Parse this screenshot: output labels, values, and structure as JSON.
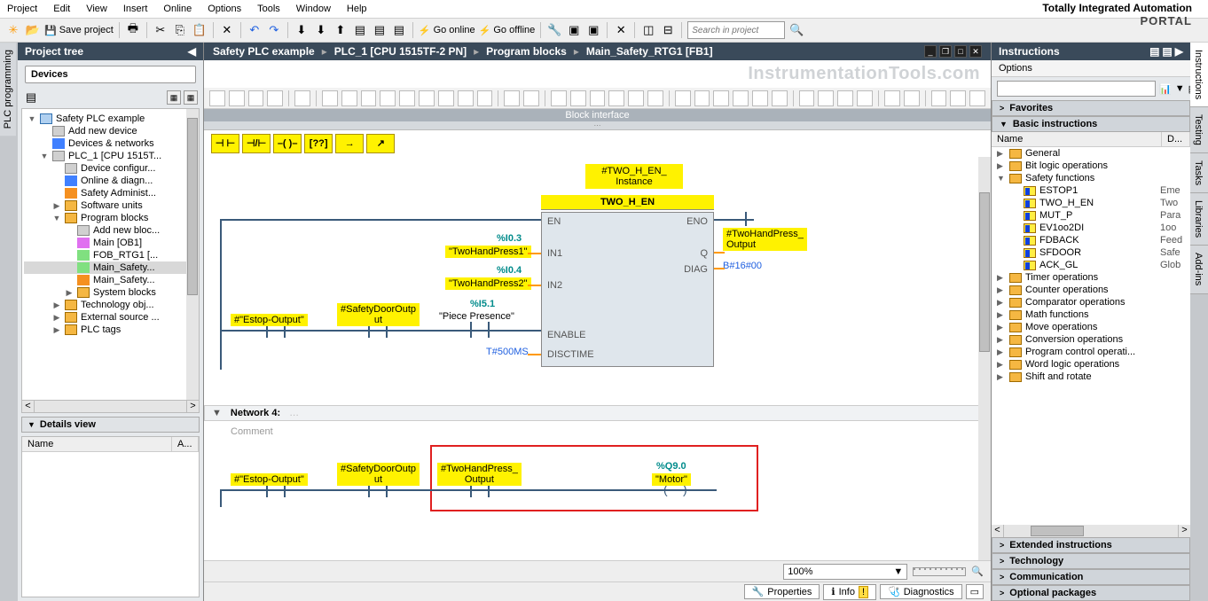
{
  "brand_top": "Totally Integrated Automation",
  "brand_bottom": "PORTAL",
  "menubar": [
    "Project",
    "Edit",
    "View",
    "Insert",
    "Online",
    "Options",
    "Tools",
    "Window",
    "Help"
  ],
  "main_toolbar": {
    "save_label": "Save project",
    "go_online": "Go online",
    "go_offline": "Go offline",
    "search_placeholder": "Search in project"
  },
  "project_tree": {
    "title": "Project tree",
    "devices_tab": "Devices",
    "items": [
      {
        "indent": 0,
        "exp": "▼",
        "icon": "fi-file",
        "label": "Safety PLC example"
      },
      {
        "indent": 1,
        "exp": "",
        "icon": "fi-gear",
        "label": "Add new device"
      },
      {
        "indent": 1,
        "exp": "",
        "icon": "fi-blue",
        "label": "Devices & networks"
      },
      {
        "indent": 1,
        "exp": "▼",
        "icon": "fi-gear",
        "label": "PLC_1 [CPU 1515T..."
      },
      {
        "indent": 2,
        "exp": "",
        "icon": "fi-gear",
        "label": "Device configur..."
      },
      {
        "indent": 2,
        "exp": "",
        "icon": "fi-blue",
        "label": "Online & diagn..."
      },
      {
        "indent": 2,
        "exp": "",
        "icon": "fi-orange",
        "label": "Safety Administ..."
      },
      {
        "indent": 2,
        "exp": "▶",
        "icon": "fi-folder",
        "label": "Software units"
      },
      {
        "indent": 2,
        "exp": "▼",
        "icon": "fi-folder",
        "label": "Program blocks"
      },
      {
        "indent": 3,
        "exp": "",
        "icon": "fi-gear",
        "label": "Add new bloc..."
      },
      {
        "indent": 3,
        "exp": "",
        "icon": "fi-purple",
        "label": "Main [OB1]"
      },
      {
        "indent": 3,
        "exp": "",
        "icon": "fi-green",
        "label": "FOB_RTG1 [..."
      },
      {
        "indent": 3,
        "exp": "",
        "icon": "fi-green",
        "label": "Main_Safety...",
        "hl": true
      },
      {
        "indent": 3,
        "exp": "",
        "icon": "fi-orange",
        "label": "Main_Safety..."
      },
      {
        "indent": 3,
        "exp": "▶",
        "icon": "fi-folder",
        "label": "System blocks"
      },
      {
        "indent": 2,
        "exp": "▶",
        "icon": "fi-folder",
        "label": "Technology obj..."
      },
      {
        "indent": 2,
        "exp": "▶",
        "icon": "fi-folder",
        "label": "External source ..."
      },
      {
        "indent": 2,
        "exp": "▶",
        "icon": "fi-folder",
        "label": "PLC tags"
      }
    ],
    "details_title": "Details view",
    "col_name": "Name",
    "col_addr": "A..."
  },
  "breadcrumb": [
    "Safety PLC example",
    "PLC_1 [CPU 1515TF-2 PN]",
    "Program blocks",
    "Main_Safety_RTG1 [FB1]"
  ],
  "watermark": "InstrumentationTools.com",
  "block_interface": "Block interface",
  "favorites": [
    "⊣ ⊢",
    "⊣/⊢",
    "–( )–",
    "[??]",
    "→",
    "↗"
  ],
  "ladder": {
    "instance_label": "#TWO_H_EN_\nInstance",
    "block_name": "TWO_H_EN",
    "ports_left": [
      "EN",
      "IN1",
      "IN2",
      "",
      "",
      "ENABLE",
      "DISCTIME"
    ],
    "ports_right": [
      "ENO",
      "Q",
      "DIAG"
    ],
    "in1_addr": "%I0.3",
    "in1_tag": "\"TwoHandPress1\"",
    "in2_addr": "%I0.4",
    "in2_tag": "\"TwoHandPress2\"",
    "piece_addr": "%I5.1",
    "piece_tag": "\"Piece Presence\"",
    "disctime_val": "T#500MS",
    "q_tag": "#TwoHandPress_\nOutput",
    "diag_val": "B#16#00",
    "estop": "#\"Estop-Output\"",
    "safedoor": "#SafetyDoorOutput",
    "network4": "Network 4:",
    "comment": "Comment",
    "n4_twohand": "#TwoHandPress_\nOutput",
    "motor_addr": "%Q9.0",
    "motor_tag": "\"Motor\""
  },
  "zoom": "100%",
  "bottom_tabs": {
    "properties": "Properties",
    "info": "Info",
    "diag": "Diagnostics"
  },
  "instructions": {
    "title": "Instructions",
    "options": "Options",
    "favorites": "Favorites",
    "basic": "Basic instructions",
    "col_name": "Name",
    "col_d": "D...",
    "rows": [
      {
        "exp": "▶",
        "icon": "ic-folder",
        "name": "General",
        "desc": ""
      },
      {
        "exp": "▶",
        "icon": "ic-folder",
        "name": "Bit logic operations",
        "desc": ""
      },
      {
        "exp": "▼",
        "icon": "ic-folder",
        "name": "Safety functions",
        "desc": ""
      },
      {
        "exp": "",
        "icon": "ic-safe",
        "name": "ESTOP1",
        "desc": "Eme",
        "indent": 1
      },
      {
        "exp": "",
        "icon": "ic-safe",
        "name": "TWO_H_EN",
        "desc": "Two",
        "indent": 1
      },
      {
        "exp": "",
        "icon": "ic-safe",
        "name": "MUT_P",
        "desc": "Para",
        "indent": 1
      },
      {
        "exp": "",
        "icon": "ic-safe",
        "name": "EV1oo2DI",
        "desc": "1oo",
        "indent": 1
      },
      {
        "exp": "",
        "icon": "ic-safe",
        "name": "FDBACK",
        "desc": "Feed",
        "indent": 1
      },
      {
        "exp": "",
        "icon": "ic-safe",
        "name": "SFDOOR",
        "desc": "Safe",
        "indent": 1
      },
      {
        "exp": "",
        "icon": "ic-safe",
        "name": "ACK_GL",
        "desc": "Glob",
        "indent": 1
      },
      {
        "exp": "▶",
        "icon": "ic-folder",
        "name": "Timer operations",
        "desc": ""
      },
      {
        "exp": "▶",
        "icon": "ic-folder",
        "name": "Counter operations",
        "desc": ""
      },
      {
        "exp": "▶",
        "icon": "ic-folder",
        "name": "Comparator operations",
        "desc": ""
      },
      {
        "exp": "▶",
        "icon": "ic-folder",
        "name": "Math functions",
        "desc": ""
      },
      {
        "exp": "▶",
        "icon": "ic-folder",
        "name": "Move operations",
        "desc": ""
      },
      {
        "exp": "▶",
        "icon": "ic-folder",
        "name": "Conversion operations",
        "desc": ""
      },
      {
        "exp": "▶",
        "icon": "ic-folder",
        "name": "Program control operati...",
        "desc": ""
      },
      {
        "exp": "▶",
        "icon": "ic-folder",
        "name": "Word logic operations",
        "desc": ""
      },
      {
        "exp": "▶",
        "icon": "ic-folder",
        "name": "Shift and rotate",
        "desc": ""
      }
    ],
    "sections": [
      "Extended instructions",
      "Technology",
      "Communication",
      "Optional packages"
    ]
  },
  "left_vtab": "PLC programming",
  "right_vtabs": [
    "Instructions",
    "Testing",
    "Tasks",
    "Libraries",
    "Add-ins"
  ]
}
